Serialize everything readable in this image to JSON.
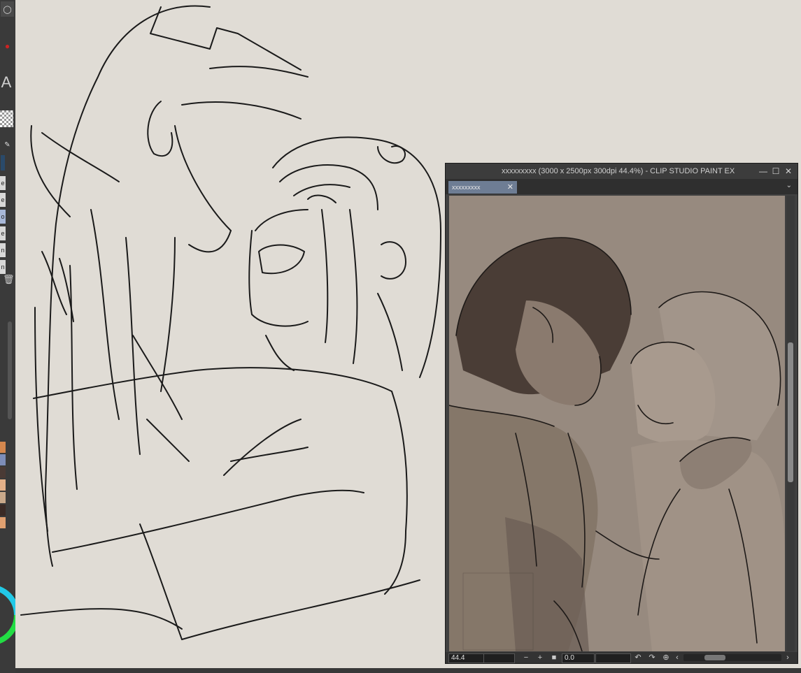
{
  "app": {
    "name": "CLIP STUDIO PAINT EX"
  },
  "colors": {
    "canvas_bg": "#e0dcd5",
    "sub_canvas_bg": "#978a7f",
    "ui_dark": "#3a3a3a",
    "tab_active": "#6e7d94",
    "color_wheel_green": "#22dd44",
    "color_wheel_cyan": "#22c8e8"
  },
  "left_strip": {
    "text_tool_letter": "A",
    "layer_labels": [
      "e",
      "e",
      "o",
      "e",
      "n",
      "n"
    ],
    "palette_colors": [
      "#d4874e",
      "#7d8db8",
      "#4a3a35",
      "#e4b088",
      "#c8a88a",
      "#3a2a25",
      "#e0a070"
    ],
    "icons": [
      "pen-icon",
      "transparency-icon",
      "trash-icon",
      "color-wheel-icon"
    ]
  },
  "sub_window": {
    "title": "xxxxxxxxx (3000 x 2500px 300dpi 44.4%)  - CLIP STUDIO PAINT EX",
    "controls": [
      "minimize-icon",
      "maximize-icon",
      "close-icon"
    ],
    "tab_label": "xxxxxxxxx",
    "status": {
      "zoom_value": "44.4",
      "rotation_value": "0.0",
      "zoom_out": "−",
      "zoom_in": "+",
      "icons": [
        "rotate-left-icon",
        "rotate-right-icon",
        "reset-rotation-icon",
        "scroll-left-icon",
        "scroll-right-icon"
      ]
    }
  }
}
